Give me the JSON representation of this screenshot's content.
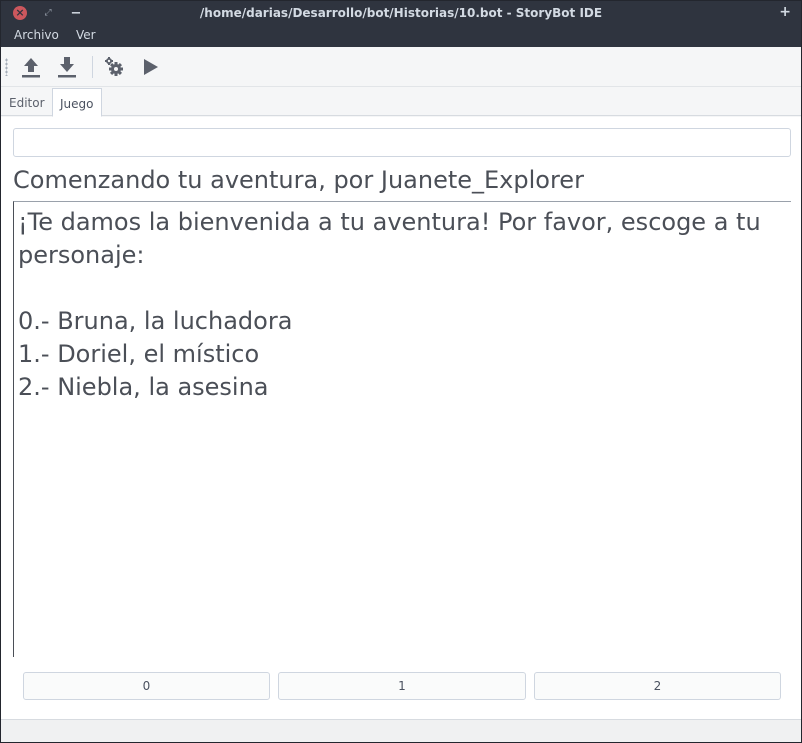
{
  "window": {
    "title": "/home/darias/Desarrollo/bot/Historias/10.bot - StoryBot IDE",
    "close_glyph": "×",
    "maximize_glyph": "⤢",
    "minimize_glyph": "−",
    "pin_glyph": "+"
  },
  "menubar": {
    "items": [
      {
        "label": "Archivo"
      },
      {
        "label": "Ver"
      }
    ]
  },
  "toolbar": {
    "tools": [
      {
        "icon": "upload-icon"
      },
      {
        "icon": "download-icon"
      },
      {
        "icon": "settings-icon"
      },
      {
        "icon": "play-icon"
      }
    ],
    "icon_color": "#5c616c"
  },
  "tabs": [
    {
      "label": "Editor",
      "active": false
    },
    {
      "label": "Juego",
      "active": true
    }
  ],
  "game": {
    "input_value": "",
    "title": "Comenzando tu aventura, por Juanete_Explorer",
    "text": "¡Te damos la bienvenida a tu aventura! Por favor, escoge a tu personaje:\n\n0.- Bruna, la luchadora\n1.- Doriel, el místico\n2.- Niebla, la asesina",
    "options": [
      {
        "label": "0"
      },
      {
        "label": "1"
      },
      {
        "label": "2"
      }
    ]
  },
  "colors": {
    "titlebar_bg": "#2f343f",
    "titlebar_text": "#d3dae3",
    "close_button": "#cc575d",
    "text": "#4b4f57"
  }
}
